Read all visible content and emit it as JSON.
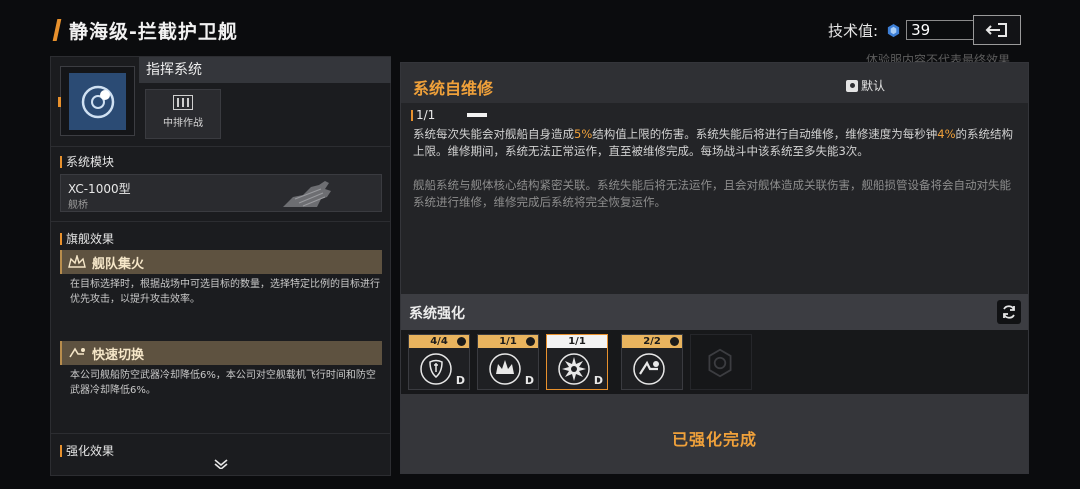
{
  "header": {
    "title": "静海级-拦截护卫舰",
    "tech_label": "技术值:",
    "tech_value": "39",
    "disclaimer": "体验服内容不代表最终效果",
    "exit_icon": "exit-icon"
  },
  "left": {
    "system_title": "指挥系统",
    "system_icon": "target-icon",
    "mode_label": "中排作战",
    "module_section": "系统模块",
    "module_name": "XC-1000型",
    "module_sub": "舰桥",
    "flagship_section": "旗舰效果",
    "flagship_effects": [
      {
        "label": "舰队集火",
        "icon": "crown-icon",
        "desc": "在目标选择时，根据战场中可选目标的数量，选择特定比例的目标进行优先攻击，以提升攻击效率。"
      },
      {
        "label": "快速切换",
        "icon": "swap-icon",
        "desc": "本公司舰船防空武器冷却降低6%，本公司对空舰载机飞行时间和防空武器冷却降低6%。"
      }
    ],
    "enhance_section": "强化效果"
  },
  "right": {
    "title": "系统自维修",
    "default_label": "默认",
    "level": "1/1",
    "desc1_parts": [
      "系统每次失能会对舰船自身造成",
      "5%",
      "结构值上限的伤害。系统失能后将进行自动维修，维修速度为每秒钟",
      "4%",
      "的系统结构上限。维修期间，系统无法正常运作，直至被维修完成。每场战斗中该系统至多失能3次。"
    ],
    "desc2": "舰船系统与舰体核心结构紧密关联。系统失能后将无法运作，且会对舰体造成关联伤害，舰船损管设备将会自动对失能系统进行维修，维修完成后系统将完全恢复运作。",
    "enhance_title": "系统强化",
    "slots": [
      {
        "count": "4/4",
        "grade": "D"
      },
      {
        "count": "1/1",
        "grade": "D"
      },
      {
        "count": "1/1",
        "grade": "D"
      },
      {
        "count": "2/2",
        "grade": ""
      }
    ],
    "done_text": "已强化完成"
  },
  "colors": {
    "accent": "#e8912d",
    "highlight": "#f0a13a"
  }
}
